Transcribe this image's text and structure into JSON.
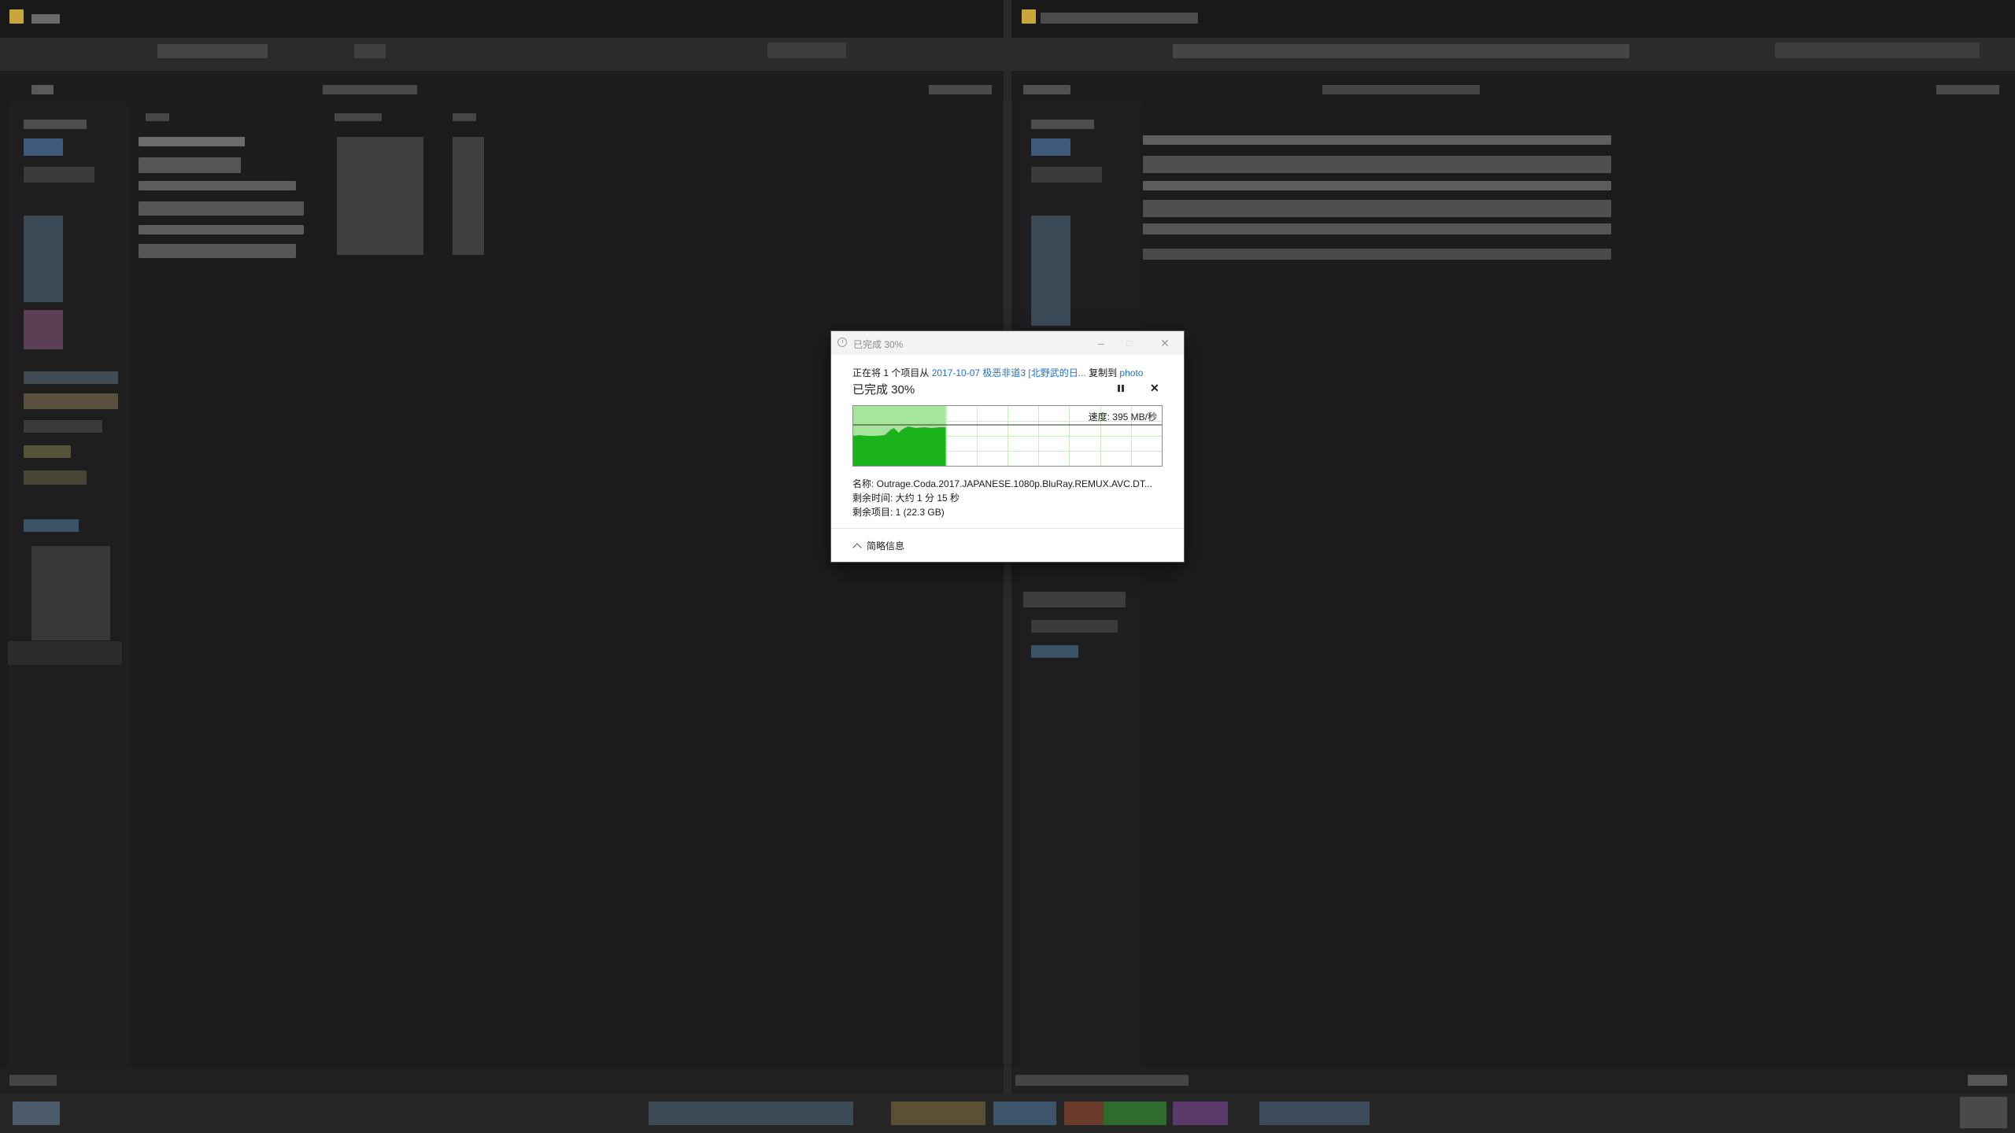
{
  "copy_dialog": {
    "title": "已完成 30%",
    "status_prefix": "正在将 1 个项目从 ",
    "source": "2017-10-07 极恶非道3 [北野武的日...",
    "middle": " 复制到 ",
    "destination": "photo",
    "percent_text": "已完成 30%",
    "progress": 0.3,
    "speed_text": "速度: 395 MB/秒",
    "name_line": "名称: Outrage.Coda.2017.JAPANESE.1080p.BluRay.REMUX.AVC.DT...",
    "time_left_line": "剩余时间: 大约 1 分 15 秒",
    "items_left_line": "剩余项目: 1 (22.3 GB)",
    "less_details_label": "简略信息",
    "minimize_glyph": "–",
    "maximize_glyph": "□",
    "close_glyph": "✕",
    "stop_glyph": "✕"
  },
  "colors": {
    "graph_fill": "#1bb31b",
    "graph_fill_light": "#a6e59a",
    "link": "#1f6fc5"
  },
  "icons": [
    "clock-icon",
    "pause-icon",
    "stop-icon",
    "chevron-up-icon",
    "folder-icon"
  ]
}
